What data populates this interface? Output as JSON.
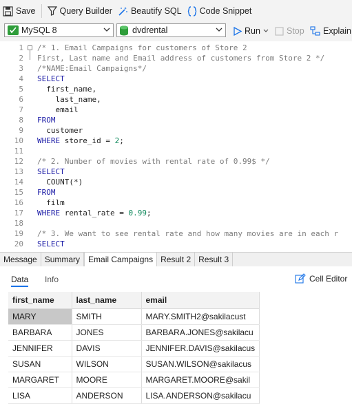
{
  "toolbar": {
    "save": "Save",
    "query_builder": "Query Builder",
    "beautify_sql": "Beautify SQL",
    "code_snippet": "Code Snippet"
  },
  "connection": {
    "type": "MySQL 8",
    "database": "dvdrental"
  },
  "actions": {
    "run": "Run",
    "stop": "Stop",
    "explain": "Explain"
  },
  "editor": {
    "lines": [
      {
        "n": "1",
        "parts": [
          [
            "cm",
            "/* 1. Email Campaigns for customers of Store 2"
          ]
        ]
      },
      {
        "n": "2",
        "parts": [
          [
            "cm",
            "First, Last name and Email address of customers from Store 2 */"
          ]
        ]
      },
      {
        "n": "3",
        "parts": [
          [
            "cm",
            "/*NAME:Email Campaigns*/"
          ]
        ]
      },
      {
        "n": "4",
        "parts": [
          [
            "kw",
            "SELECT"
          ]
        ]
      },
      {
        "n": "5",
        "parts": [
          [
            "plain",
            "  first_name,"
          ]
        ]
      },
      {
        "n": "6",
        "parts": [
          [
            "plain",
            "    last_name,"
          ]
        ]
      },
      {
        "n": "7",
        "parts": [
          [
            "plain",
            "    email"
          ]
        ]
      },
      {
        "n": "8",
        "parts": [
          [
            "kw",
            "FROM"
          ]
        ]
      },
      {
        "n": "9",
        "parts": [
          [
            "plain",
            "  customer"
          ]
        ]
      },
      {
        "n": "10",
        "parts": [
          [
            "kw",
            "WHERE"
          ],
          [
            "plain",
            " store_id = "
          ],
          [
            "num",
            "2"
          ],
          [
            "plain",
            ";"
          ]
        ]
      },
      {
        "n": "11",
        "parts": []
      },
      {
        "n": "12",
        "parts": [
          [
            "cm",
            "/* 2. Number of movies with rental rate of 0.99$ */"
          ]
        ]
      },
      {
        "n": "13",
        "parts": [
          [
            "kw",
            "SELECT"
          ]
        ]
      },
      {
        "n": "14",
        "parts": [
          [
            "plain",
            "  COUNT(*)"
          ]
        ]
      },
      {
        "n": "15",
        "parts": [
          [
            "kw",
            "FROM"
          ]
        ]
      },
      {
        "n": "16",
        "parts": [
          [
            "plain",
            "  film"
          ]
        ]
      },
      {
        "n": "17",
        "parts": [
          [
            "kw",
            "WHERE"
          ],
          [
            "plain",
            " rental_rate = "
          ],
          [
            "num",
            "0.99"
          ],
          [
            "plain",
            ";"
          ]
        ]
      },
      {
        "n": "18",
        "parts": []
      },
      {
        "n": "19",
        "parts": [
          [
            "cm",
            "/* 3. We want to see rental rate and how many movies are in each r"
          ]
        ]
      },
      {
        "n": "20",
        "parts": [
          [
            "kw",
            "SELECT"
          ]
        ]
      }
    ]
  },
  "result_tabs": [
    "Message",
    "Summary",
    "Email Campaigns",
    "Result 2",
    "Result 3"
  ],
  "subtabs": {
    "data": "Data",
    "info": "Info",
    "cell_editor": "Cell Editor"
  },
  "table": {
    "columns": [
      "first_name",
      "last_name",
      "email"
    ],
    "rows": [
      [
        "MARY",
        "SMITH",
        "MARY.SMITH2@sakilacust"
      ],
      [
        "BARBARA",
        "JONES",
        "BARBARA.JONES@sakilacu"
      ],
      [
        "JENNIFER",
        "DAVIS",
        "JENNIFER.DAVIS@sakilacus"
      ],
      [
        "SUSAN",
        "WILSON",
        "SUSAN.WILSON@sakilacus"
      ],
      [
        "MARGARET",
        "MOORE",
        "MARGARET.MOORE@sakil"
      ],
      [
        "LISA",
        "ANDERSON",
        "LISA.ANDERSON@sakilacu"
      ]
    ]
  }
}
